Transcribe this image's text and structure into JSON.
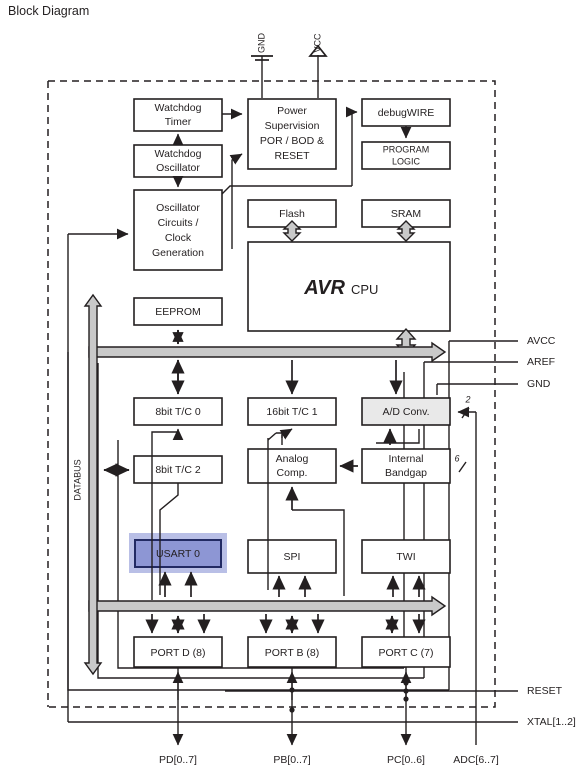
{
  "page": {
    "title": "Block Diagram"
  },
  "pins": {
    "top": [
      {
        "name": "GND",
        "symbol": "ground-symbol"
      },
      {
        "name": "VCC",
        "symbol": "supply-arrow-symbol"
      }
    ],
    "right": [
      "AVCC",
      "AREF",
      "GND",
      "RESET",
      "XTAL[1..2]"
    ],
    "bottom": [
      "PD[0..7]",
      "PB[0..7]",
      "PC[0..6]",
      "ADC[6..7]"
    ]
  },
  "bus": {
    "label": "DATABUS"
  },
  "bus_widths": [
    {
      "label": "2",
      "at": "ad-conv-right"
    },
    {
      "label": "6",
      "at": "adc-input"
    }
  ],
  "blocks": [
    {
      "id": "watchdog-timer",
      "lines": [
        "Watchdog",
        "Timer"
      ]
    },
    {
      "id": "watchdog-oscillator",
      "lines": [
        "Watchdog",
        "Oscillator"
      ]
    },
    {
      "id": "oscillator-circuits",
      "lines": [
        "Oscillator",
        "Circuits /",
        "Clock",
        "Generation"
      ]
    },
    {
      "id": "power-supervision",
      "lines": [
        "Power",
        "Supervision",
        "POR / BOD &",
        "RESET"
      ]
    },
    {
      "id": "debugwire",
      "lines": [
        "debugWIRE"
      ]
    },
    {
      "id": "program-logic",
      "lines": [
        "PROGRAM",
        "LOGIC"
      ]
    },
    {
      "id": "flash",
      "lines": [
        "Flash"
      ]
    },
    {
      "id": "sram",
      "lines": [
        "SRAM"
      ]
    },
    {
      "id": "avr-cpu",
      "lines": [
        "AVR",
        "CPU"
      ]
    },
    {
      "id": "eeprom",
      "lines": [
        "EEPROM"
      ]
    },
    {
      "id": "tc0",
      "lines": [
        "8bit T/C 0"
      ]
    },
    {
      "id": "tc1",
      "lines": [
        "16bit T/C 1"
      ]
    },
    {
      "id": "ad-conv",
      "lines": [
        "A/D Conv."
      ]
    },
    {
      "id": "tc2",
      "lines": [
        "8bit T/C 2"
      ]
    },
    {
      "id": "analog-comp",
      "lines": [
        "Analog",
        "Comp."
      ]
    },
    {
      "id": "internal-bandgap",
      "lines": [
        "Internal",
        "Bandgap"
      ]
    },
    {
      "id": "usart0",
      "lines": [
        "USART 0"
      ],
      "highlight": true
    },
    {
      "id": "spi",
      "lines": [
        "SPI"
      ]
    },
    {
      "id": "twi",
      "lines": [
        "TWI"
      ]
    },
    {
      "id": "port-d",
      "lines": [
        "PORT D (8)"
      ]
    },
    {
      "id": "port-b",
      "lines": [
        "PORT B (8)"
      ]
    },
    {
      "id": "port-c",
      "lines": [
        "PORT C (7)"
      ]
    }
  ],
  "text": {
    "watchdog_timer_1": "Watchdog",
    "watchdog_timer_2": "Timer",
    "watchdog_osc_1": "Watchdog",
    "watchdog_osc_2": "Oscillator",
    "osc_1": "Oscillator",
    "osc_2": "Circuits /",
    "osc_3": "Clock",
    "osc_4": "Generation",
    "pwr_1": "Power",
    "pwr_2": "Supervision",
    "pwr_3": "POR / BOD &",
    "pwr_4": "RESET",
    "debugwire": "debugWIRE",
    "proglogic_1": "PROGRAM",
    "proglogic_2": "LOGIC",
    "flash": "Flash",
    "sram": "SRAM",
    "avr": "AVR",
    "cpu": "CPU",
    "eeprom": "EEPROM",
    "tc0": "8bit T/C 0",
    "tc1": "16bit T/C 1",
    "adconv": "A/D Conv.",
    "tc2": "8bit T/C 2",
    "acomp_1": "Analog",
    "acomp_2": "Comp.",
    "bandgap_1": "Internal",
    "bandgap_2": "Bandgap",
    "usart0": "USART 0",
    "spi": "SPI",
    "twi": "TWI",
    "portd": "PORT D (8)",
    "portb": "PORT B (8)",
    "portc": "PORT C (7)",
    "databus": "DATABUS",
    "gnd_top": "GND",
    "vcc_top": "VCC",
    "avcc": "AVCC",
    "aref": "AREF",
    "gnd_right": "GND",
    "reset": "RESET",
    "xtal": "XTAL[1..2]",
    "pd": "PD[0..7]",
    "pb": "PB[0..7]",
    "pc": "PC[0..6]",
    "adc": "ADC[6..7]",
    "num2": "2",
    "num6": "6"
  },
  "colors": {
    "ink": "#231f20",
    "bus_gray": "#c9c9c9",
    "block_gray": "#e9e9e9",
    "highlight_fill": "#8d96d4",
    "highlight_border": "#222a63",
    "highlight_halo": "#b9bfe6"
  }
}
